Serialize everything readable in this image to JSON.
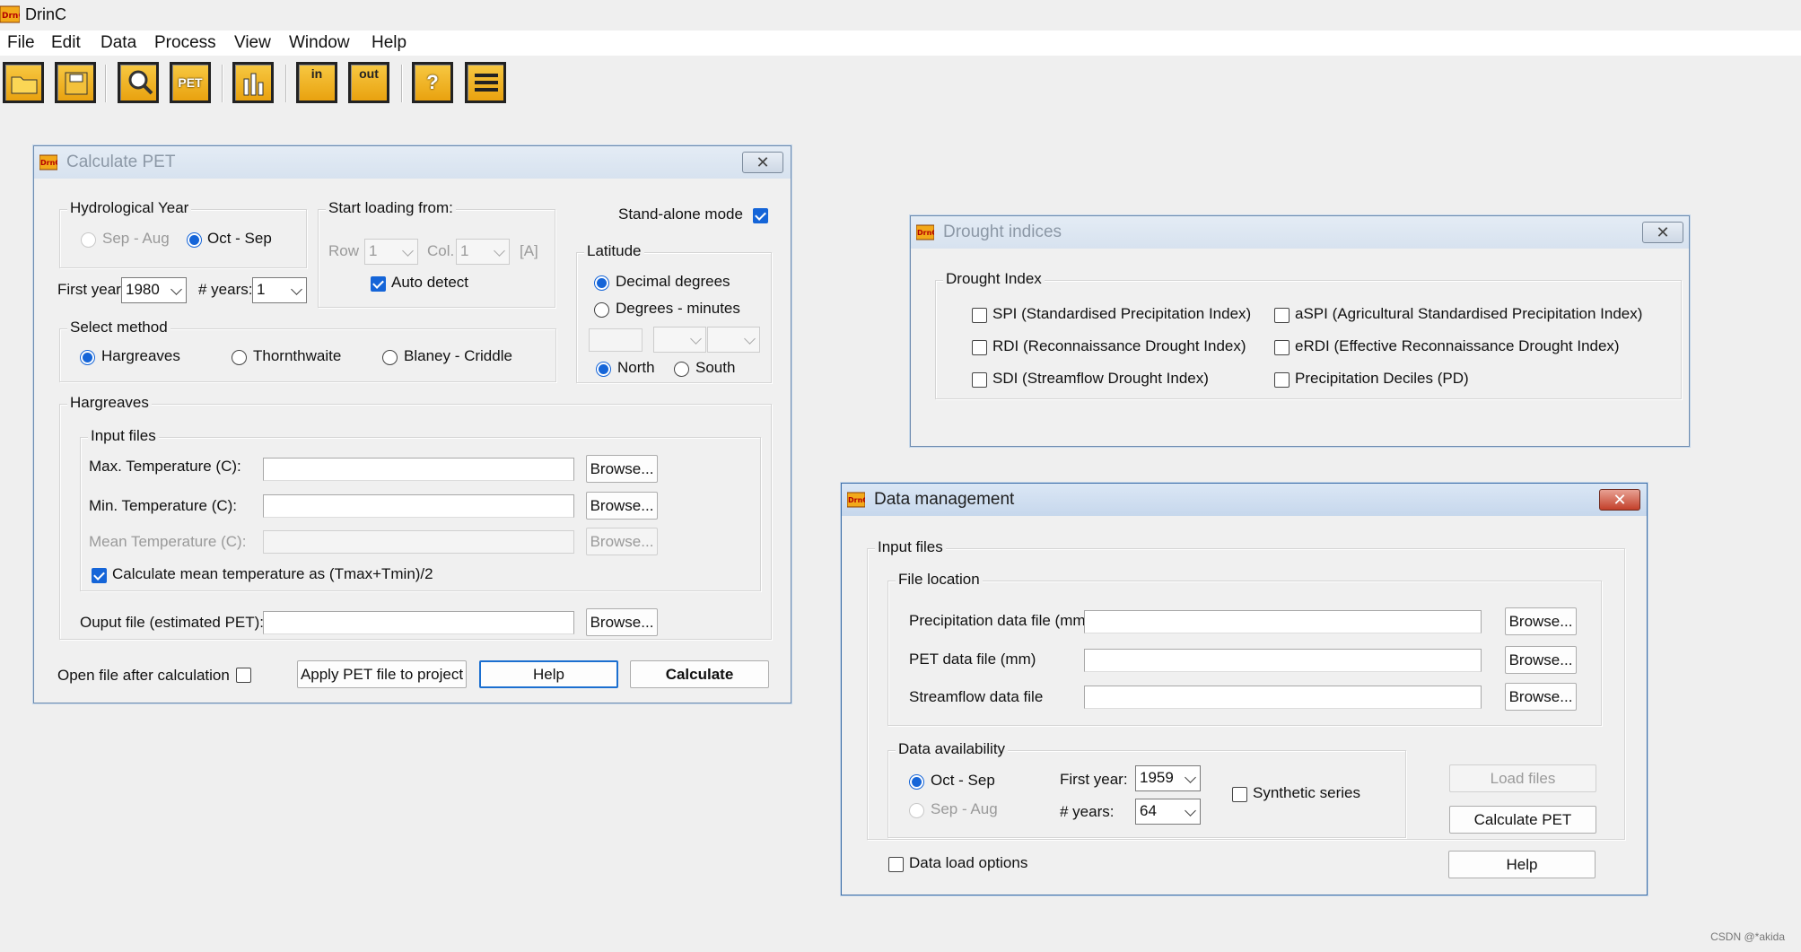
{
  "app": {
    "title": "DrinC"
  },
  "menu": [
    "File",
    "Edit",
    "Data",
    "Process",
    "View",
    "Window",
    "Help"
  ],
  "toolbar": {
    "pet_label": "PET",
    "in_label": "in",
    "out_label": "out",
    "help_label": "?"
  },
  "pet_dialog": {
    "title": "Calculate PET",
    "hydro_year": {
      "label": "Hydrological Year",
      "opt1": "Sep - Aug",
      "opt2": "Oct - Sep",
      "first_year_label": "First year:",
      "first_year": "1980",
      "years_label": "# years:",
      "years": "1"
    },
    "start_loading": {
      "label": "Start loading from:",
      "row_label": "Row",
      "row": "1",
      "col_label": "Col.",
      "col": "1",
      "a_label": "[A]",
      "auto_detect": "Auto detect"
    },
    "standalone": "Stand-alone mode",
    "latitude": {
      "label": "Latitude",
      "decimal": "Decimal degrees",
      "dms": "Degrees - minutes",
      "north": "North",
      "south": "South"
    },
    "method": {
      "label": "Select method",
      "opt1": "Hargreaves",
      "opt2": "Thornthwaite",
      "opt3": "Blaney - Criddle"
    },
    "hargreaves": {
      "label": "Hargreaves",
      "input_files": "Input files",
      "max_temp": "Max. Temperature (C):",
      "min_temp": "Min. Temperature (C):",
      "mean_temp": "Mean Temperature (C):",
      "calc_mean": "Calculate mean temperature as (Tmax+Tmin)/2",
      "output": "Ouput file (estimated PET):",
      "browse": "Browse..."
    },
    "open_after": "Open file after calculation",
    "apply": "Apply PET file to project",
    "help": "Help",
    "calculate": "Calculate"
  },
  "drought_dialog": {
    "title": "Drought indices",
    "group": "Drought Index",
    "spi": "SPI (Standardised Precipitation Index)",
    "rdi": "RDI (Reconnaissance Drought Index)",
    "sdi": "SDI (Streamflow Drought Index)",
    "aspi": "aSPI (Agricultural Standardised Precipitation Index)",
    "erdi": "eRDI (Effective Reconnaissance Drought Index)",
    "pd": "Precipitation Deciles (PD)"
  },
  "data_dialog": {
    "title": "Data management",
    "input_files": "Input files",
    "file_location": "File location",
    "precip": "Precipitation data file (mm)",
    "pet": "PET data file (mm)",
    "streamflow": "Streamflow data file",
    "browse": "Browse...",
    "availability": "Data availability",
    "opt1": "Oct - Sep",
    "opt2": "Sep - Aug",
    "first_year_label": "First year:",
    "first_year": "1959",
    "years_label": "# years:",
    "years": "64",
    "synthetic": "Synthetic series",
    "load_files": "Load files",
    "calc_pet": "Calculate PET",
    "data_load_options": "Data load options",
    "help": "Help"
  },
  "watermark": "CSDN @*akida",
  "colors": {
    "accent": "#1565d8",
    "toolbar_icon": "#e9a20f"
  }
}
